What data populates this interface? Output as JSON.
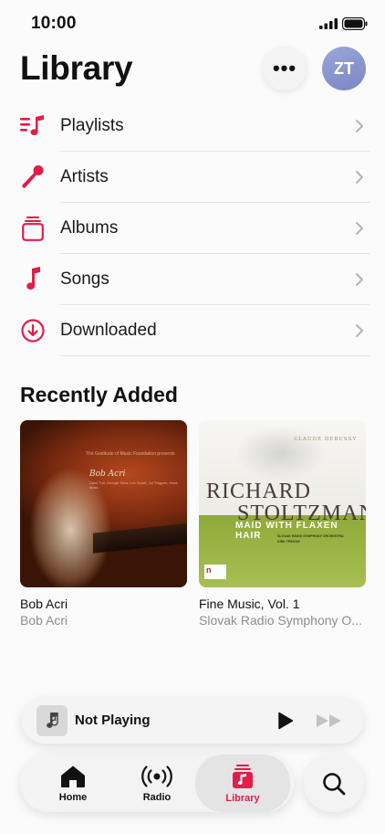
{
  "status_bar": {
    "time": "10:00"
  },
  "header": {
    "title": "Library",
    "more_label": "•••",
    "avatar_initials": "ZT"
  },
  "library_items": [
    {
      "label": "Playlists",
      "icon": "playlist-icon"
    },
    {
      "label": "Artists",
      "icon": "microphone-icon"
    },
    {
      "label": "Albums",
      "icon": "album-stack-icon"
    },
    {
      "label": "Songs",
      "icon": "music-note-icon"
    },
    {
      "label": "Downloaded",
      "icon": "download-circle-icon"
    }
  ],
  "recently_added": {
    "title": "Recently Added",
    "albums": [
      {
        "name": "Bob Acri",
        "artist": "Bob Acri",
        "art_text": [
          "The Gratitude of Music Foundation presents",
          "Bob Acri",
          "Dave Tull, George Silva, Lee Scruff, Jul Thigpen, Hank Moss"
        ]
      },
      {
        "name": "Fine Music, Vol. 1",
        "artist": "Slovak Radio Symphony O...",
        "art_text": [
          "CLAUDE DEBUSSY",
          "RICHARD",
          "STOLTZMAN",
          "MAID WITH FLAXEN HAIR",
          "SLOVAK RADIO SYMPHONY ORCHESTRA",
          "KIRK TREVOR",
          "Naxos Records"
        ]
      }
    ]
  },
  "mini_player": {
    "title": "Not Playing"
  },
  "tab_bar": {
    "tabs": [
      {
        "label": "Home",
        "icon": "home-icon"
      },
      {
        "label": "Radio",
        "icon": "radio-icon"
      },
      {
        "label": "Library",
        "icon": "library-icon",
        "active": true
      }
    ],
    "search_icon": "search-icon"
  },
  "colors": {
    "accent": "#e11d48",
    "secondary_text": "#8d8d8d",
    "divider": "#e2e2e2"
  }
}
